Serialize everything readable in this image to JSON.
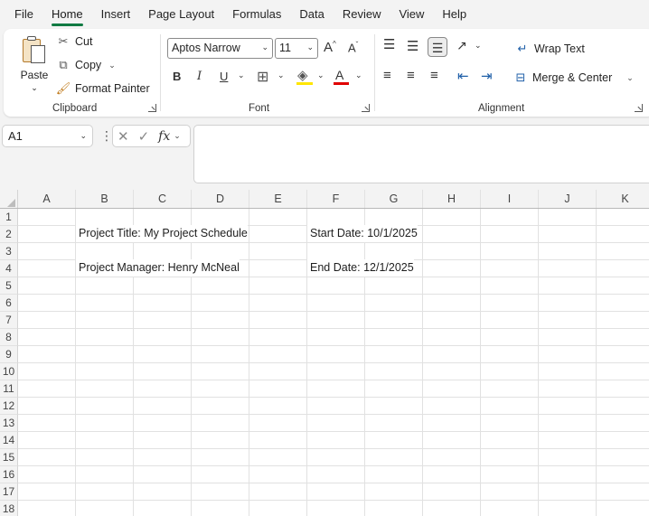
{
  "menu": {
    "tabs": [
      "File",
      "Home",
      "Insert",
      "Page Layout",
      "Formulas",
      "Data",
      "Review",
      "View",
      "Help"
    ],
    "active": "Home"
  },
  "ribbon": {
    "clipboard": {
      "paste_label": "Paste",
      "cut_label": "Cut",
      "copy_label": "Copy",
      "format_painter_label": "Format Painter",
      "group_label": "Clipboard"
    },
    "font": {
      "font_name": "Aptos Narrow",
      "font_size": "11",
      "bold": "B",
      "italic": "I",
      "underline": "U",
      "font_color_glyph": "A",
      "group_label": "Font",
      "highlight_color": "#ffe600",
      "font_color": "#e00000"
    },
    "alignment": {
      "wrap_text_label": "Wrap Text",
      "merge_center_label": "Merge & Center",
      "group_label": "Alignment"
    }
  },
  "formula_bar": {
    "name_box": "A1",
    "fx_label": "fx",
    "formula": ""
  },
  "grid": {
    "columns": [
      "A",
      "B",
      "C",
      "D",
      "E",
      "F",
      "G",
      "H",
      "I",
      "J",
      "K"
    ],
    "rows": [
      "1",
      "2",
      "3",
      "4",
      "5",
      "6",
      "7",
      "8",
      "9",
      "10",
      "11",
      "12",
      "13",
      "14",
      "15",
      "16",
      "17",
      "18"
    ],
    "cells": {
      "B2": "Project Title: My Project Schedule",
      "F2": "Start Date: 10/1/2025",
      "B4": "Project Manager: Henry McNeal",
      "F4": "End Date: 12/1/2025"
    }
  },
  "colors": {
    "accent": "#117a43"
  }
}
